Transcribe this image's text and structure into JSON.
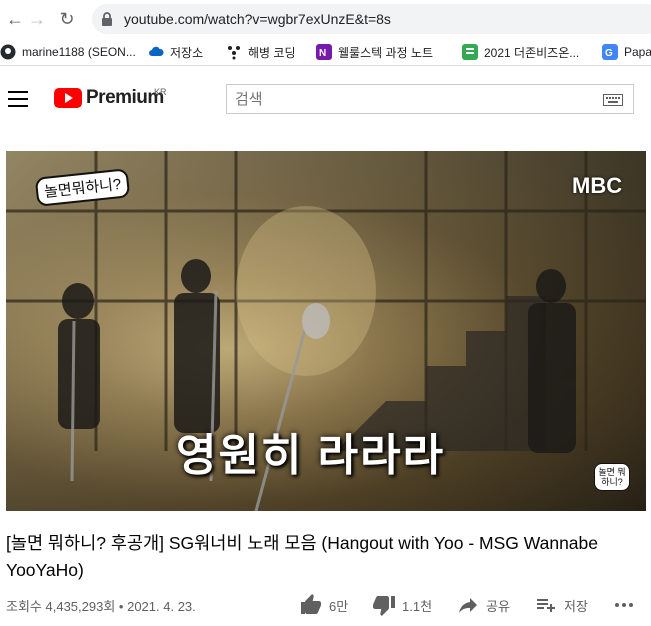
{
  "browser": {
    "url": "youtube.com/watch?v=wgbr7exUnzE&t=8s"
  },
  "bookmarks": [
    {
      "label": "marine1188 (SEON...",
      "icon": "github-icon",
      "color": "#24292e"
    },
    {
      "label": "저장소",
      "icon": "cloud-icon",
      "color": "#0a66c2"
    },
    {
      "label": "해병 코딩",
      "icon": "app-icon",
      "color": "#202124"
    },
    {
      "label": "웰룰스텍 과정 노트",
      "icon": "onenote-icon",
      "color": "#7719aa"
    },
    {
      "label": "2021 더존비즈온...",
      "icon": "form-icon",
      "color": "#34a853"
    },
    {
      "label": "Papa",
      "icon": "translate-icon",
      "color": "#4285f4"
    }
  ],
  "youtube": {
    "brand": "Premium",
    "region": "KR",
    "search_placeholder": "검색"
  },
  "video": {
    "caption": "영원히 라라라",
    "show_logo": "놀면뭐하니?",
    "channel_logo": "MBC",
    "corner_logo": "놀면 뭐하니?"
  },
  "title": "[놀면 뭐하니? 후공개] SG워너비 노래 모음 (Hangout with Yoo - MSG Wannabe YooYaHo)",
  "meta": {
    "views": "조회수 4,435,293회",
    "date": "2021. 4. 23.",
    "likes": "6만",
    "dislikes": "1.1천",
    "share": "공유",
    "save": "저장"
  },
  "colors": {
    "brand_red": "#ff0000",
    "icon_gray": "#606060"
  }
}
